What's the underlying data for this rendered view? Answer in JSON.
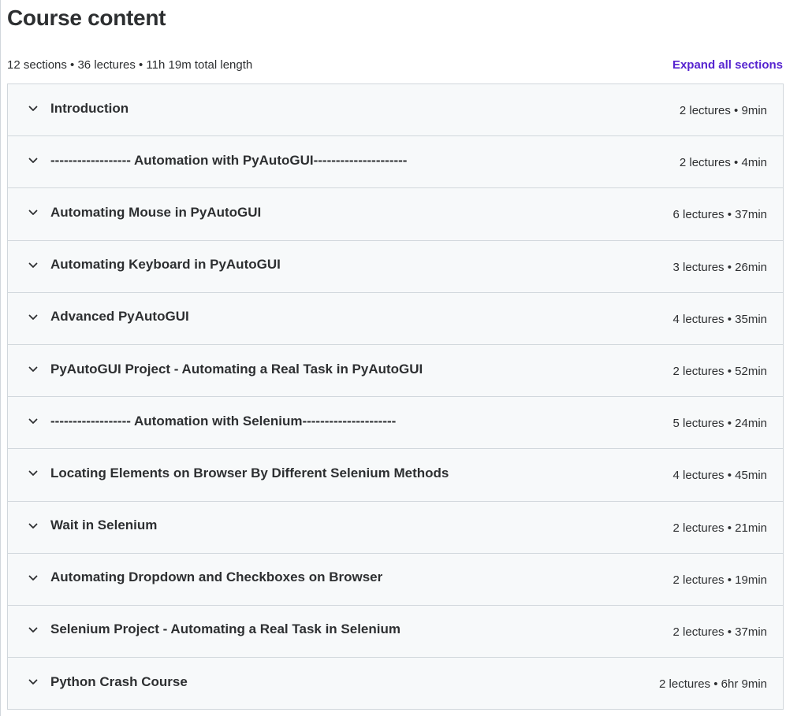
{
  "header": {
    "title": "Course content",
    "summary": "12 sections • 36 lectures • 11h 19m total length",
    "expand_all_label": "Expand all sections",
    "accent_color": "#5624d0"
  },
  "sections": [
    {
      "title": "Introduction",
      "meta": "2 lectures • 9min"
    },
    {
      "title": "------------------ Automation with PyAutoGUI---------------------",
      "meta": "2 lectures • 4min"
    },
    {
      "title": "Automating Mouse in PyAutoGUI",
      "meta": "6 lectures • 37min"
    },
    {
      "title": "Automating Keyboard in PyAutoGUI",
      "meta": "3 lectures • 26min"
    },
    {
      "title": "Advanced PyAutoGUI",
      "meta": "4 lectures • 35min"
    },
    {
      "title": "PyAutoGUI Project - Automating a Real Task in PyAutoGUI",
      "meta": "2 lectures • 52min"
    },
    {
      "title": "------------------ Automation with Selenium---------------------",
      "meta": "5 lectures • 24min"
    },
    {
      "title": "Locating Elements on Browser By Different Selenium Methods",
      "meta": "4 lectures • 45min"
    },
    {
      "title": "Wait in Selenium",
      "meta": "2 lectures • 21min"
    },
    {
      "title": "Automating Dropdown and Checkboxes on Browser",
      "meta": "2 lectures • 19min"
    },
    {
      "title": "Selenium Project - Automating a Real Task in Selenium",
      "meta": "2 lectures • 37min"
    },
    {
      "title": "Python Crash Course",
      "meta": "2 lectures • 6hr 9min"
    }
  ],
  "icons": {
    "section_toggle": "chevron-down-icon"
  }
}
